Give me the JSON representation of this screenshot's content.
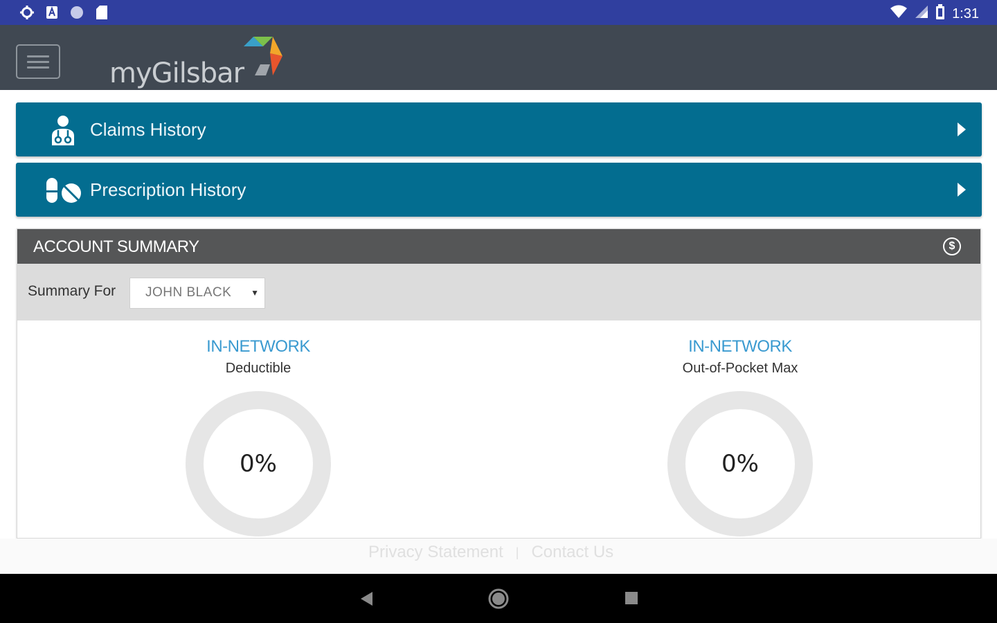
{
  "status_bar": {
    "time": "1:31",
    "icons": [
      "gear-icon",
      "a-icon",
      "circle-icon",
      "sd-card-icon",
      "wifi-icon",
      "signal-icon",
      "battery-icon"
    ]
  },
  "header": {
    "logo_text": "myGilsbar",
    "colors": {
      "background": "#404852",
      "logo_text": "#c9cdd1"
    }
  },
  "nav_buttons": [
    {
      "label": "Claims History",
      "icon": "doctor-icon"
    },
    {
      "label": "Prescription History",
      "icon": "pills-icon"
    }
  ],
  "account_summary": {
    "title": "ACCOUNT SUMMARY",
    "icon": "dollar-circle-icon",
    "summary_for_label": "Summary For",
    "selected_member": "JOHN BLACK",
    "metrics": [
      {
        "network": "IN-NETWORK",
        "label": "Deductible",
        "percent": "0%"
      },
      {
        "network": "IN-NETWORK",
        "label": "Out-of-Pocket Max",
        "percent": "0%"
      }
    ]
  },
  "footer": {
    "links": [
      "Privacy Statement",
      "Contact Us"
    ],
    "separator": "|"
  },
  "colors": {
    "status_bar": "#303f9f",
    "accent": "#036d90",
    "summary_header": "#555657",
    "network_blue": "#3a9ad0"
  }
}
